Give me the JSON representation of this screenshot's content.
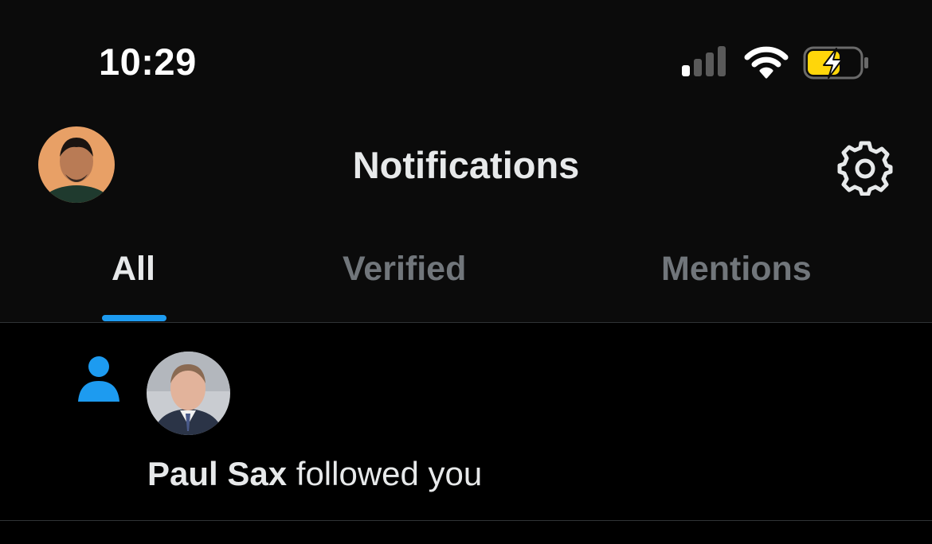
{
  "status_bar": {
    "time": "10:29",
    "icons": [
      "cellular-signal-icon",
      "wifi-icon",
      "battery-charging-icon"
    ],
    "battery_color": "#ffd60a"
  },
  "nav": {
    "title": "Notifications",
    "avatar": "profile-avatar",
    "settings_icon": "gear-icon"
  },
  "tabs": [
    {
      "label": "All",
      "active": true
    },
    {
      "label": "Verified",
      "active": false
    },
    {
      "label": "Mentions",
      "active": false
    }
  ],
  "notifications": [
    {
      "type": "follow",
      "icon": "person-icon",
      "user": "Paul Sax",
      "action": "followed you"
    }
  ],
  "colors": {
    "accent": "#1d9bf0",
    "text_primary": "#e7e9ea",
    "text_secondary": "#71767b",
    "background": "#000000",
    "header_background": "#0b0b0b"
  }
}
